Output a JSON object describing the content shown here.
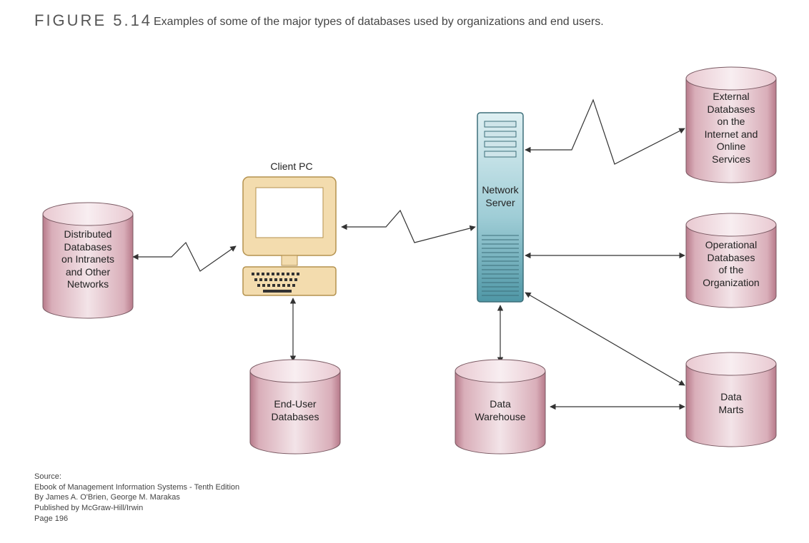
{
  "figure": {
    "number": "FIGURE 5.14",
    "caption": "Examples of some of the major types of databases used by organizations and end users."
  },
  "nodes": {
    "client_pc_label": "Client PC",
    "network_server_label": "Network Server",
    "distributed_db": "Distributed\nDatabases\non Intranets\nand Other\nNetworks",
    "end_user_db": "End-User\nDatabases",
    "data_warehouse": "Data\nWarehouse",
    "external_db": "External\nDatabases\non the\nInternet and\nOnline\nServices",
    "operational_db": "Operational\nDatabases\nof the\nOrganization",
    "data_marts": "Data\nMarts"
  },
  "source": {
    "title": "Source:",
    "line1": "Ebook of Management Information Systems - Tenth Edition",
    "line2": "By James A. O'Brien, George M. Marakas",
    "line3": "Published by McGraw-Hill/Irwin",
    "line4": "Page 196"
  }
}
